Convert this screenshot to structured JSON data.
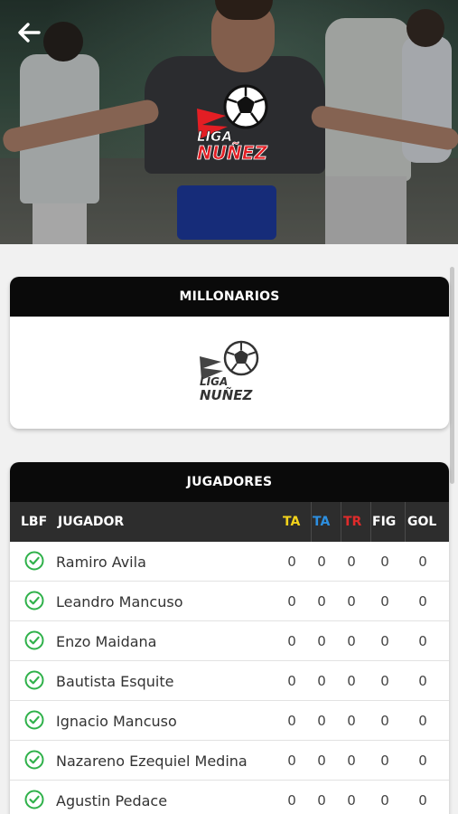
{
  "league": {
    "logo_text_line1": "LIGA",
    "logo_text_line2": "NUÑEZ"
  },
  "team": {
    "title": "MILLONARIOS"
  },
  "players_section": {
    "title": "JUGADORES",
    "columns": [
      {
        "key": "lbf",
        "label": "LBF",
        "color": "#ffffff"
      },
      {
        "key": "jugador",
        "label": "JUGADOR",
        "color": "#ffffff"
      },
      {
        "key": "ta1",
        "label": "TA",
        "color": "#f2d21b"
      },
      {
        "key": "ta2",
        "label": "TA",
        "color": "#2d8fe0"
      },
      {
        "key": "tr",
        "label": "TR",
        "color": "#e02b2b"
      },
      {
        "key": "fig",
        "label": "FIG",
        "color": "#ffffff"
      },
      {
        "key": "gol",
        "label": "GOL",
        "color": "#ffffff"
      }
    ],
    "rows": [
      {
        "name": "Ramiro Avila",
        "ta1": "0",
        "ta2": "0",
        "tr": "0",
        "fig": "0",
        "gol": "0"
      },
      {
        "name": "Leandro Mancuso",
        "ta1": "0",
        "ta2": "0",
        "tr": "0",
        "fig": "0",
        "gol": "0"
      },
      {
        "name": "Enzo Maidana",
        "ta1": "0",
        "ta2": "0",
        "tr": "0",
        "fig": "0",
        "gol": "0"
      },
      {
        "name": "Bautista Esquite",
        "ta1": "0",
        "ta2": "0",
        "tr": "0",
        "fig": "0",
        "gol": "0"
      },
      {
        "name": "Ignacio Mancuso",
        "ta1": "0",
        "ta2": "0",
        "tr": "0",
        "fig": "0",
        "gol": "0"
      },
      {
        "name": "Nazareno Ezequiel Medina",
        "ta1": "0",
        "ta2": "0",
        "tr": "0",
        "fig": "0",
        "gol": "0"
      },
      {
        "name": "Agustin Pedace",
        "ta1": "0",
        "ta2": "0",
        "tr": "0",
        "fig": "0",
        "gol": "0"
      }
    ]
  },
  "icons": {
    "back": "arrow-left-icon",
    "status": "check-circle-icon",
    "ball": "soccer-ball-icon"
  },
  "colors": {
    "accent_green": "#2fb14a",
    "header_black": "#0a0a0a",
    "table_header": "#2d2d2d",
    "logo_red": "#e31e24"
  }
}
